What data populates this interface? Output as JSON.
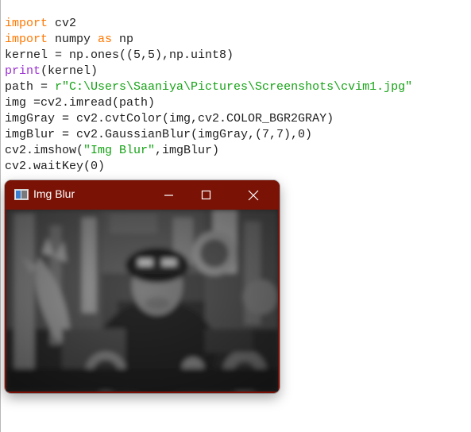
{
  "code_lines": [
    {
      "parts": [
        {
          "t": "import",
          "c": "kw"
        },
        {
          "t": " cv2",
          "c": ""
        }
      ]
    },
    {
      "parts": [
        {
          "t": "import",
          "c": "kw"
        },
        {
          "t": " numpy ",
          "c": ""
        },
        {
          "t": "as",
          "c": "kw"
        },
        {
          "t": " np",
          "c": ""
        }
      ]
    },
    {
      "parts": [
        {
          "t": "kernel = np.ones((5,5),np.uint8)",
          "c": ""
        }
      ]
    },
    {
      "parts": [
        {
          "t": "print",
          "c": "bi"
        },
        {
          "t": "(kernel)",
          "c": ""
        }
      ]
    },
    {
      "parts": [
        {
          "t": "path = ",
          "c": ""
        },
        {
          "t": "r\"C:\\Users\\Saaniya\\Pictures\\Screenshots\\cvim1.jpg\"",
          "c": "str"
        }
      ]
    },
    {
      "parts": [
        {
          "t": "img =cv2.imread(path)",
          "c": ""
        }
      ]
    },
    {
      "parts": [
        {
          "t": "imgGray = cv2.cvtColor(img,cv2.COLOR_BGR2GRAY)",
          "c": ""
        }
      ]
    },
    {
      "parts": [
        {
          "t": "imgBlur = cv2.GaussianBlur(imgGray,(7,7),0)",
          "c": ""
        }
      ]
    },
    {
      "parts": [
        {
          "t": "cv2.imshow(",
          "c": ""
        },
        {
          "t": "\"Img Blur\"",
          "c": "str"
        },
        {
          "t": ",imgBlur)",
          "c": ""
        }
      ]
    },
    {
      "parts": [
        {
          "t": "cv2.waitKey(0)",
          "c": ""
        }
      ]
    }
  ],
  "window": {
    "title": "Img Blur",
    "accent": "#7a1206"
  },
  "colors": {
    "keyword": "#ff7700",
    "builtin": "#9b2fd1",
    "string": "#16a316"
  },
  "icons": {
    "app": "image-window-icon",
    "minimize": "minimize-icon",
    "maximize": "maximize-icon",
    "close": "close-icon"
  }
}
